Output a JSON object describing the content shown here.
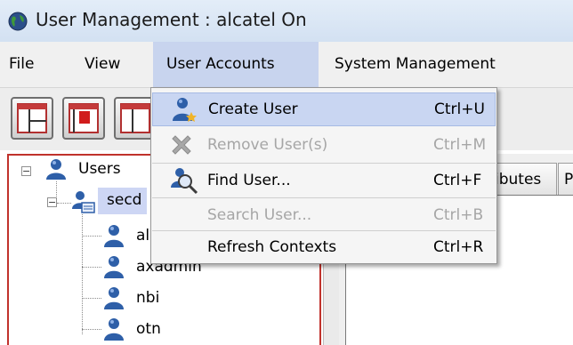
{
  "window": {
    "title": "User Management : alcatel On",
    "app_icon": "globe-icon"
  },
  "menubar": {
    "items": [
      "File",
      "View",
      "User Accounts",
      "System Management"
    ],
    "active": "User Accounts"
  },
  "toolbar": {
    "buttons": [
      "layout-split-icon",
      "layout-red-icon",
      "layout-partial-icon"
    ]
  },
  "tree": {
    "root_label": "Users",
    "group_label": "secd",
    "children": [
      "al",
      "axadmin",
      "nbi",
      "otn"
    ]
  },
  "tabs": {
    "attributes_partial": "ributes",
    "next_partial": "P"
  },
  "user_accounts_menu": {
    "items": [
      {
        "label": "Create User",
        "shortcut": "Ctrl+U",
        "enabled": true,
        "highlighted": true,
        "icon": "user-add-icon"
      },
      {
        "label": "Remove User(s)",
        "shortcut": "Ctrl+M",
        "enabled": false,
        "icon": "remove-x-icon"
      },
      {
        "label": "Find User...",
        "shortcut": "Ctrl+F",
        "enabled": true,
        "icon": "find-user-icon"
      },
      {
        "label": "Search User...",
        "shortcut": "Ctrl+B",
        "enabled": false
      },
      {
        "label": "Refresh Contexts",
        "shortcut": "Ctrl+R",
        "enabled": true
      }
    ]
  },
  "colors": {
    "menu_highlight": "#c9d6f2",
    "panel_border_red": "#c0322c",
    "disabled_text": "#a6a6a6"
  }
}
